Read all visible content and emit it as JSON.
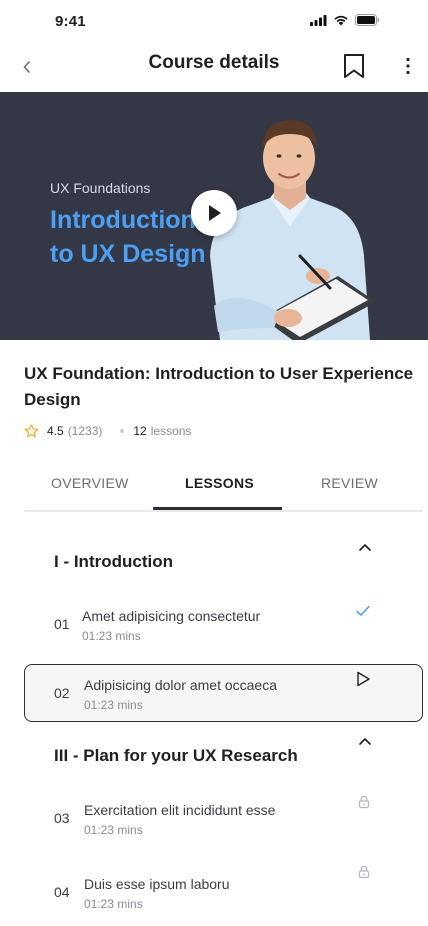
{
  "status": {
    "time": "9:41"
  },
  "nav": {
    "title": "Course details"
  },
  "hero": {
    "eyebrow": "UX Foundations",
    "title_line1": "Introduction",
    "title_line2": "to UX Design"
  },
  "course": {
    "title": "UX Foundation: Introduction to User Experience Design",
    "rating": "4.5",
    "rating_count": "(1233)",
    "lessons_count": "12",
    "lessons_label": "lessons"
  },
  "tabs": [
    {
      "label": "OVERVIEW"
    },
    {
      "label": "LESSONS"
    },
    {
      "label": "REVIEW"
    }
  ],
  "sections": [
    {
      "title": "I - Introduction",
      "lessons": [
        {
          "number": "01",
          "name": "Amet adipisicing consectetur",
          "duration": "01:23 mins",
          "status_icon": "check-icon"
        },
        {
          "number": "02",
          "name": "Adipisicing dolor amet occaeca",
          "duration": "01:23 mins",
          "status_icon": "play-icon"
        }
      ]
    },
    {
      "title": "III - Plan for your UX Research",
      "lessons": [
        {
          "number": "03",
          "name": "Exercitation elit incididunt esse",
          "duration": "01:23 mins",
          "status_icon": "lock-icon"
        },
        {
          "number": "04",
          "name": "Duis esse ipsum laboru",
          "duration": "01:23 mins",
          "status_icon": "lock-icon"
        }
      ]
    }
  ],
  "colors": {
    "accent": "#4c9ff2",
    "hero_bg": "#343745",
    "star": "#f2b233",
    "check": "#4c9ff2"
  }
}
